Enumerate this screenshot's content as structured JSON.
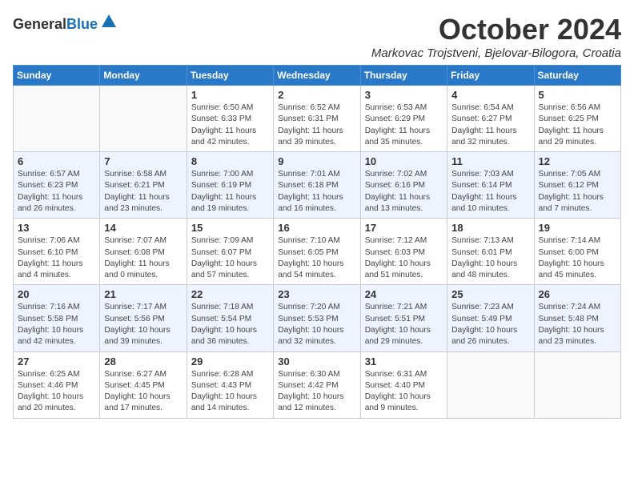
{
  "header": {
    "logo_general": "General",
    "logo_blue": "Blue",
    "month_title": "October 2024",
    "location": "Markovac Trojstveni, Bjelovar-Bilogora, Croatia"
  },
  "weekdays": [
    "Sunday",
    "Monday",
    "Tuesday",
    "Wednesday",
    "Thursday",
    "Friday",
    "Saturday"
  ],
  "weeks": [
    [
      {
        "day": "",
        "info": ""
      },
      {
        "day": "",
        "info": ""
      },
      {
        "day": "1",
        "info": "Sunrise: 6:50 AM\nSunset: 6:33 PM\nDaylight: 11 hours\nand 42 minutes."
      },
      {
        "day": "2",
        "info": "Sunrise: 6:52 AM\nSunset: 6:31 PM\nDaylight: 11 hours\nand 39 minutes."
      },
      {
        "day": "3",
        "info": "Sunrise: 6:53 AM\nSunset: 6:29 PM\nDaylight: 11 hours\nand 35 minutes."
      },
      {
        "day": "4",
        "info": "Sunrise: 6:54 AM\nSunset: 6:27 PM\nDaylight: 11 hours\nand 32 minutes."
      },
      {
        "day": "5",
        "info": "Sunrise: 6:56 AM\nSunset: 6:25 PM\nDaylight: 11 hours\nand 29 minutes."
      }
    ],
    [
      {
        "day": "6",
        "info": "Sunrise: 6:57 AM\nSunset: 6:23 PM\nDaylight: 11 hours\nand 26 minutes."
      },
      {
        "day": "7",
        "info": "Sunrise: 6:58 AM\nSunset: 6:21 PM\nDaylight: 11 hours\nand 23 minutes."
      },
      {
        "day": "8",
        "info": "Sunrise: 7:00 AM\nSunset: 6:19 PM\nDaylight: 11 hours\nand 19 minutes."
      },
      {
        "day": "9",
        "info": "Sunrise: 7:01 AM\nSunset: 6:18 PM\nDaylight: 11 hours\nand 16 minutes."
      },
      {
        "day": "10",
        "info": "Sunrise: 7:02 AM\nSunset: 6:16 PM\nDaylight: 11 hours\nand 13 minutes."
      },
      {
        "day": "11",
        "info": "Sunrise: 7:03 AM\nSunset: 6:14 PM\nDaylight: 11 hours\nand 10 minutes."
      },
      {
        "day": "12",
        "info": "Sunrise: 7:05 AM\nSunset: 6:12 PM\nDaylight: 11 hours\nand 7 minutes."
      }
    ],
    [
      {
        "day": "13",
        "info": "Sunrise: 7:06 AM\nSunset: 6:10 PM\nDaylight: 11 hours\nand 4 minutes."
      },
      {
        "day": "14",
        "info": "Sunrise: 7:07 AM\nSunset: 6:08 PM\nDaylight: 11 hours\nand 0 minutes."
      },
      {
        "day": "15",
        "info": "Sunrise: 7:09 AM\nSunset: 6:07 PM\nDaylight: 10 hours\nand 57 minutes."
      },
      {
        "day": "16",
        "info": "Sunrise: 7:10 AM\nSunset: 6:05 PM\nDaylight: 10 hours\nand 54 minutes."
      },
      {
        "day": "17",
        "info": "Sunrise: 7:12 AM\nSunset: 6:03 PM\nDaylight: 10 hours\nand 51 minutes."
      },
      {
        "day": "18",
        "info": "Sunrise: 7:13 AM\nSunset: 6:01 PM\nDaylight: 10 hours\nand 48 minutes."
      },
      {
        "day": "19",
        "info": "Sunrise: 7:14 AM\nSunset: 6:00 PM\nDaylight: 10 hours\nand 45 minutes."
      }
    ],
    [
      {
        "day": "20",
        "info": "Sunrise: 7:16 AM\nSunset: 5:58 PM\nDaylight: 10 hours\nand 42 minutes."
      },
      {
        "day": "21",
        "info": "Sunrise: 7:17 AM\nSunset: 5:56 PM\nDaylight: 10 hours\nand 39 minutes."
      },
      {
        "day": "22",
        "info": "Sunrise: 7:18 AM\nSunset: 5:54 PM\nDaylight: 10 hours\nand 36 minutes."
      },
      {
        "day": "23",
        "info": "Sunrise: 7:20 AM\nSunset: 5:53 PM\nDaylight: 10 hours\nand 32 minutes."
      },
      {
        "day": "24",
        "info": "Sunrise: 7:21 AM\nSunset: 5:51 PM\nDaylight: 10 hours\nand 29 minutes."
      },
      {
        "day": "25",
        "info": "Sunrise: 7:23 AM\nSunset: 5:49 PM\nDaylight: 10 hours\nand 26 minutes."
      },
      {
        "day": "26",
        "info": "Sunrise: 7:24 AM\nSunset: 5:48 PM\nDaylight: 10 hours\nand 23 minutes."
      }
    ],
    [
      {
        "day": "27",
        "info": "Sunrise: 6:25 AM\nSunset: 4:46 PM\nDaylight: 10 hours\nand 20 minutes."
      },
      {
        "day": "28",
        "info": "Sunrise: 6:27 AM\nSunset: 4:45 PM\nDaylight: 10 hours\nand 17 minutes."
      },
      {
        "day": "29",
        "info": "Sunrise: 6:28 AM\nSunset: 4:43 PM\nDaylight: 10 hours\nand 14 minutes."
      },
      {
        "day": "30",
        "info": "Sunrise: 6:30 AM\nSunset: 4:42 PM\nDaylight: 10 hours\nand 12 minutes."
      },
      {
        "day": "31",
        "info": "Sunrise: 6:31 AM\nSunset: 4:40 PM\nDaylight: 10 hours\nand 9 minutes."
      },
      {
        "day": "",
        "info": ""
      },
      {
        "day": "",
        "info": ""
      }
    ]
  ]
}
